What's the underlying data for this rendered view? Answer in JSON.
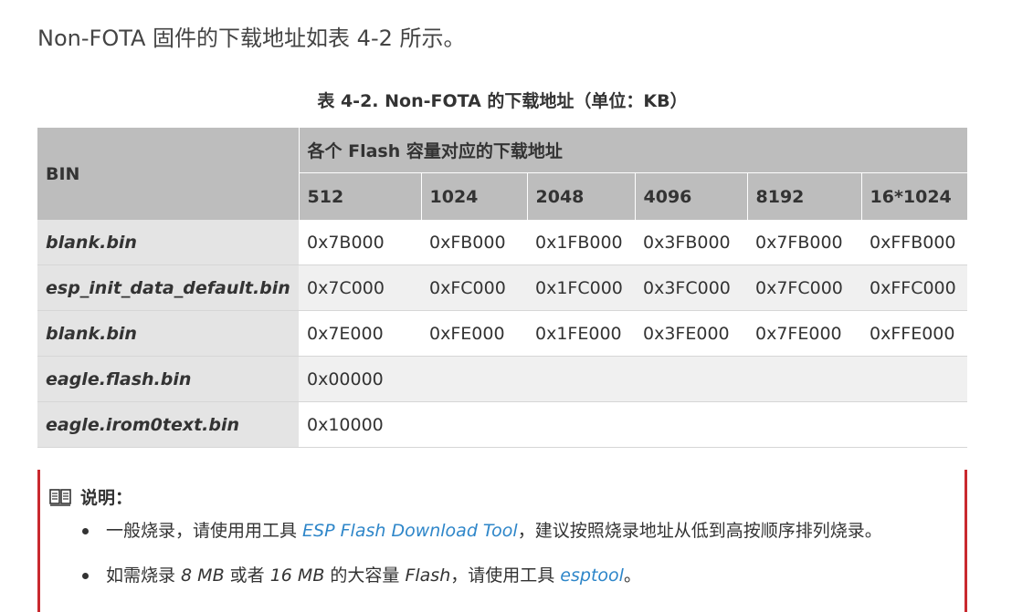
{
  "intro": "Non-FOTA 固件的下载地址如表 4-2 所示。",
  "caption": "表 4-2. Non-FOTA 的下载地址（单位：KB）",
  "table": {
    "bin_header": "BIN",
    "group_header": "各个 Flash 容量对应的下载地址",
    "sizes": [
      "512",
      "1024",
      "2048",
      "4096",
      "8192",
      "16*1024"
    ],
    "rows": [
      {
        "name": "blank.bin",
        "values": [
          "0x7B000",
          "0xFB000",
          "0x1FB000",
          "0x3FB000",
          "0x7FB000",
          "0xFFB000"
        ]
      },
      {
        "name": "esp_init_data_default.bin",
        "values": [
          "0x7C000",
          "0xFC000",
          "0x1FC000",
          "0x3FC000",
          "0x7FC000",
          "0xFFC000"
        ]
      },
      {
        "name": "blank.bin",
        "values": [
          "0x7E000",
          "0xFE000",
          "0x1FE000",
          "0x3FE000",
          "0x7FE000",
          "0xFFE000"
        ]
      },
      {
        "name": "eagle.flash.bin",
        "merged": "0x00000"
      },
      {
        "name": "eagle.irom0text.bin",
        "merged": "0x10000"
      }
    ]
  },
  "note": {
    "icon": "book-icon",
    "title": "说明：",
    "item1": {
      "before": "一般烧录，请使用用工具 ",
      "link": "ESP Flash Download Tool",
      "after": "，建议按照烧录地址从低到高按顺序排列烧录。"
    },
    "item2": {
      "p1": "如需烧录 ",
      "em1": "8 MB",
      "p2": " 或者 ",
      "em2": "16 MB",
      "p3": " 的大容量 ",
      "em3": "Flash",
      "p4": "，请使用工具 ",
      "link": "esptool",
      "p5": "。"
    }
  },
  "colors": {
    "header_bg": "#bdbdbd",
    "name_col_bg": "#e4e4e4",
    "stripe_bg": "#f0f0f0",
    "note_border": "#c9292f",
    "link": "#2e86c9"
  }
}
